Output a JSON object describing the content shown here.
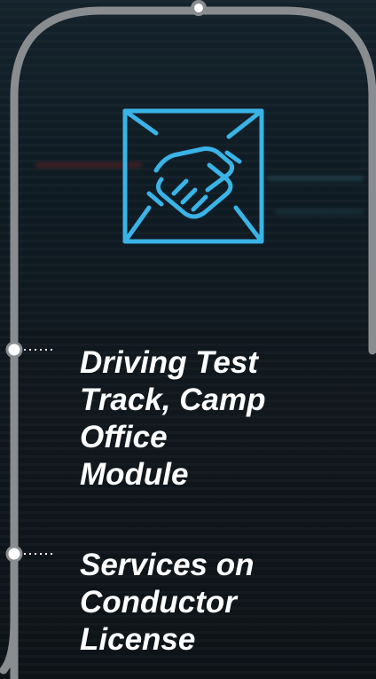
{
  "colors": {
    "frame": "#8a8d90",
    "accent": "#3ab3e6",
    "text": "#ffffff"
  },
  "icon": {
    "name": "handshake-envelope-icon"
  },
  "list": {
    "items": [
      {
        "label": "Driving Test\nTrack, Camp\nOffice\nModule",
        "bullet": "circle-bullet-icon"
      },
      {
        "label": "Services on\nConductor\nLicense",
        "bullet": "circle-bullet-icon"
      }
    ]
  }
}
